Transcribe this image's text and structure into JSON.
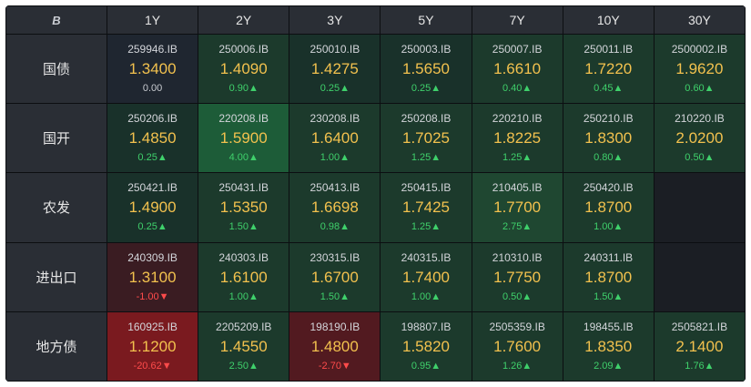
{
  "corner_logo": "B",
  "tenors": [
    "1Y",
    "2Y",
    "3Y",
    "5Y",
    "7Y",
    "10Y",
    "30Y"
  ],
  "rows": [
    {
      "label": "国债",
      "cells": [
        {
          "code": "259946.IB",
          "rate": "1.3400",
          "change": "0.00",
          "dir": "flat",
          "tone": "neutral"
        },
        {
          "code": "250006.IB",
          "rate": "1.4090",
          "change": "0.90▲",
          "dir": "up",
          "tone": "g2"
        },
        {
          "code": "250010.IB",
          "rate": "1.4275",
          "change": "0.25▲",
          "dir": "up",
          "tone": "g1"
        },
        {
          "code": "250003.IB",
          "rate": "1.5650",
          "change": "0.25▲",
          "dir": "up",
          "tone": "g1"
        },
        {
          "code": "250007.IB",
          "rate": "1.6610",
          "change": "0.40▲",
          "dir": "up",
          "tone": "g2"
        },
        {
          "code": "250011.IB",
          "rate": "1.7220",
          "change": "0.45▲",
          "dir": "up",
          "tone": "g2"
        },
        {
          "code": "2500002.IB",
          "rate": "1.9620",
          "change": "0.60▲",
          "dir": "up",
          "tone": "g2"
        }
      ]
    },
    {
      "label": "国开",
      "cells": [
        {
          "code": "250206.IB",
          "rate": "1.4850",
          "change": "0.25▲",
          "dir": "up",
          "tone": "g1"
        },
        {
          "code": "220208.IB",
          "rate": "1.5900",
          "change": "4.00▲",
          "dir": "up",
          "tone": "g4"
        },
        {
          "code": "230208.IB",
          "rate": "1.6400",
          "change": "1.00▲",
          "dir": "up",
          "tone": "g2"
        },
        {
          "code": "250208.IB",
          "rate": "1.7025",
          "change": "1.25▲",
          "dir": "up",
          "tone": "g2"
        },
        {
          "code": "220210.IB",
          "rate": "1.8225",
          "change": "1.25▲",
          "dir": "up",
          "tone": "g2"
        },
        {
          "code": "250210.IB",
          "rate": "1.8300",
          "change": "0.80▲",
          "dir": "up",
          "tone": "g2"
        },
        {
          "code": "210220.IB",
          "rate": "2.0200",
          "change": "0.50▲",
          "dir": "up",
          "tone": "g2"
        }
      ]
    },
    {
      "label": "农发",
      "cells": [
        {
          "code": "250421.IB",
          "rate": "1.4900",
          "change": "0.25▲",
          "dir": "up",
          "tone": "g1"
        },
        {
          "code": "250431.IB",
          "rate": "1.5350",
          "change": "1.50▲",
          "dir": "up",
          "tone": "g2"
        },
        {
          "code": "250413.IB",
          "rate": "1.6698",
          "change": "0.98▲",
          "dir": "up",
          "tone": "g2"
        },
        {
          "code": "250415.IB",
          "rate": "1.7425",
          "change": "1.25▲",
          "dir": "up",
          "tone": "g2"
        },
        {
          "code": "210405.IB",
          "rate": "1.7700",
          "change": "2.75▲",
          "dir": "up",
          "tone": "g3"
        },
        {
          "code": "250420.IB",
          "rate": "1.8700",
          "change": "1.00▲",
          "dir": "up",
          "tone": "g2"
        },
        {
          "code": "",
          "rate": "",
          "change": "",
          "dir": "flat",
          "tone": "empty"
        }
      ]
    },
    {
      "label": "进出口",
      "cells": [
        {
          "code": "240309.IB",
          "rate": "1.3100",
          "change": "-1.00▼",
          "dir": "down",
          "tone": "r1"
        },
        {
          "code": "240303.IB",
          "rate": "1.6100",
          "change": "1.00▲",
          "dir": "up",
          "tone": "g2"
        },
        {
          "code": "230315.IB",
          "rate": "1.6700",
          "change": "1.50▲",
          "dir": "up",
          "tone": "g2"
        },
        {
          "code": "240315.IB",
          "rate": "1.7400",
          "change": "1.00▲",
          "dir": "up",
          "tone": "g2"
        },
        {
          "code": "210310.IB",
          "rate": "1.7750",
          "change": "0.50▲",
          "dir": "up",
          "tone": "g2"
        },
        {
          "code": "240311.IB",
          "rate": "1.8700",
          "change": "1.50▲",
          "dir": "up",
          "tone": "g2"
        },
        {
          "code": "",
          "rate": "",
          "change": "",
          "dir": "flat",
          "tone": "empty"
        }
      ]
    },
    {
      "label": "地方债",
      "cells": [
        {
          "code": "160925.IB",
          "rate": "1.1200",
          "change": "-20.62▼",
          "dir": "down",
          "tone": "r3"
        },
        {
          "code": "2205209.IB",
          "rate": "1.4550",
          "change": "2.50▲",
          "dir": "up",
          "tone": "g2"
        },
        {
          "code": "198190.IB",
          "rate": "1.4800",
          "change": "-2.70▼",
          "dir": "down",
          "tone": "r2"
        },
        {
          "code": "198807.IB",
          "rate": "1.5820",
          "change": "0.95▲",
          "dir": "up",
          "tone": "g2"
        },
        {
          "code": "2505359.IB",
          "rate": "1.7600",
          "change": "1.26▲",
          "dir": "up",
          "tone": "g2"
        },
        {
          "code": "198455.IB",
          "rate": "1.8350",
          "change": "2.09▲",
          "dir": "up",
          "tone": "g2"
        },
        {
          "code": "2505821.IB",
          "rate": "2.1400",
          "change": "1.76▲",
          "dir": "up",
          "tone": "g2"
        }
      ]
    }
  ],
  "colors": {
    "rate": "#f2c14e",
    "up": "#3fd06b",
    "down": "#ff4b4b",
    "header_bg": "#2a2e35",
    "board_bg": "#1b1e24"
  }
}
